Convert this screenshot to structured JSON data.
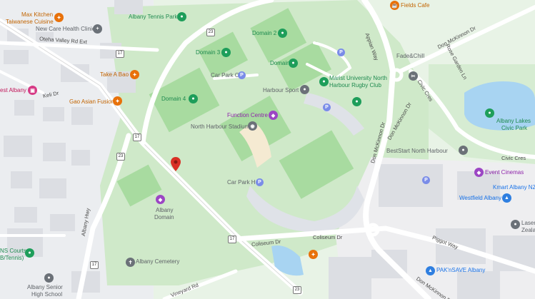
{
  "map": {
    "places": {
      "max_kitchen": "Max Kitchen",
      "taiwanese_cuisine": "Taiwanese Cuisine",
      "new_care_health_clinic": "New Care Health Clinic",
      "albany_tennis_park": "Albany Tennis Park",
      "fields_cafe": "Fields Cafe",
      "domain_2": "Domain 2",
      "domain_3": "Domain 3",
      "domain_1": "Domain 1",
      "domain_4": "Domain 4",
      "take_a_bao": "Take A Bao",
      "car_park_c": "Car Park C",
      "marist_line1": "Marist University North",
      "marist_line2": "Harbour Rugby Club",
      "harbour_sport": "Harbour Sport",
      "best_albany": "est Albany",
      "gao_asian_fusion": "Gao Asian Fusion",
      "function_centre": "Function Centre",
      "north_harbour_stadium": "North Harbour Stadium",
      "fade_chill": "Fade&Chill",
      "albany_lakes_line1": "Albany Lakes",
      "albany_lakes_line2": "Civic Park",
      "beststart": "BestStart North Harbour",
      "event_cinemas": "Event Cinemas",
      "car_park_h": "Car Park H",
      "kmart": "Kmart Albany NZ",
      "westfield": "Westfield Albany",
      "albany_domain_line1": "Albany",
      "albany_domain_line2": "Domain",
      "laser_line1": "Laser",
      "laser_line2": "Zeala",
      "ns_courts_line1": "NS Courts",
      "ns_courts_line2": "B/Tennis)",
      "albany_cemetery": "Albany Cemetery",
      "paknsave": "PAK'nSAVE Albany",
      "albany_senior_line1": "Albany Senior",
      "albany_senior_line2": "High School"
    },
    "roads": {
      "oteha_valley": "Oteha Valley Rd Ext",
      "appian_way": "Appian Way",
      "don_mckinnon_top": "Don McKinnon Dr",
      "rose_garden": "Rose Garden Ln",
      "civic_cres_left": "Civic Cres",
      "civic_cres_right": "Civic Cres",
      "don_mckinnon_mid1": "Don McKinnon Dr",
      "don_mckinnon_mid2": "Don McKinnon Dr",
      "keli_dr": "Keli Dr",
      "albany_hwy": "Albany Hwy",
      "coliseum_1": "Coliseum Dr",
      "coliseum_2": "Coliseum Dr",
      "piggott_way": "Piggot Way",
      "vineyard_rd": "Vineyard Rd",
      "don_mckinnon_bottom": "Don McKinnon Dr"
    },
    "shields": [
      "23",
      "17",
      "17",
      "23",
      "17",
      "17",
      "23"
    ],
    "parking_symbol": "P",
    "colors": {
      "park": "#c8e6c4",
      "sports_field": "#a8dba0",
      "road": "#ffffff",
      "water": "#a8d4f2",
      "building": "#dcdde3",
      "pin_red": "#d93025"
    }
  }
}
